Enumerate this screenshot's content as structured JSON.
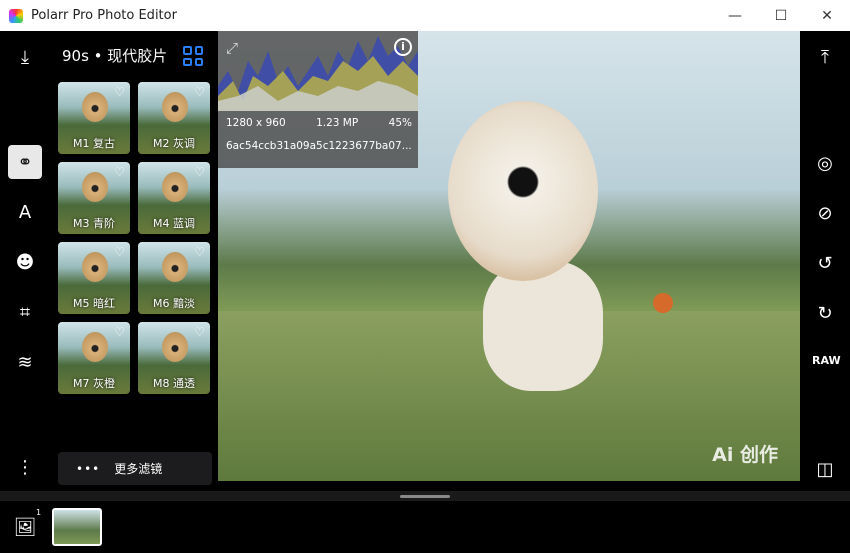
{
  "window": {
    "title": "Polarr Pro Photo Editor",
    "minimize": "—",
    "maximize": "☐",
    "close": "✕"
  },
  "panel": {
    "title": "90s • 现代胶片",
    "more_label": "更多滤镜",
    "more_icon": "•••",
    "filters": [
      {
        "label": "M1 复古"
      },
      {
        "label": "M2 灰调"
      },
      {
        "label": "M3 青阶"
      },
      {
        "label": "M4 蓝调"
      },
      {
        "label": "M5 暗红"
      },
      {
        "label": "M6 黯淡"
      },
      {
        "label": "M7 灰橙"
      },
      {
        "label": "M8 通透"
      }
    ]
  },
  "histogram": {
    "dimensions": "1280 x 960",
    "megapixels": "1.23 MP",
    "zoom": "45%",
    "hash": "6ac54ccb31a09a5c1223677ba07...",
    "info_icon": "i"
  },
  "watermark": "Ai 创作",
  "right_toolbar": {
    "raw_label": "RAW"
  },
  "filmstrip": {
    "count_badge": "1"
  },
  "colors": {
    "accent": "#2a7ef5",
    "titlebar": "#ffffff",
    "background": "#000000"
  }
}
